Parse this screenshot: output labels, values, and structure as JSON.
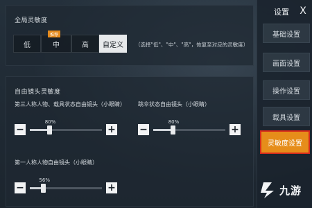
{
  "global_sensitivity": {
    "title": "全局灵敏度",
    "options": [
      {
        "label": "低",
        "selected": false
      },
      {
        "label": "中",
        "selected": false,
        "tag": "推荐"
      },
      {
        "label": "高",
        "selected": false
      },
      {
        "label": "自定义",
        "selected": true
      }
    ],
    "note": "（选择\"低\"、\"中\"、\"高\"，恢复至对应的灵敏度）"
  },
  "free_camera": {
    "title": "自由镜头灵敏度",
    "sliders": [
      {
        "label": "第三人称人物、载具状态自由镜头（小眼睛）",
        "value": 80,
        "value_text": "80%"
      },
      {
        "label": "跳伞状态自由镜头（小眼睛）",
        "value": 80,
        "value_text": "80%"
      },
      {
        "label": "第一人称人物自由镜头（小眼睛）",
        "value": 56,
        "value_text": "56%"
      }
    ],
    "slider_range": [
      0,
      300
    ],
    "minus_label": "−",
    "plus_label": "+"
  },
  "sidebar": {
    "title": "设置",
    "close_label": "X",
    "items": [
      {
        "label": "基础设置",
        "active": false
      },
      {
        "label": "画面设置",
        "active": false
      },
      {
        "label": "操作设置",
        "active": false
      },
      {
        "label": "载具设置",
        "active": false
      },
      {
        "label": "灵敏度设置",
        "active": true
      }
    ]
  },
  "watermark": {
    "text": "九游"
  },
  "colors": {
    "accent": "#e68d1a",
    "highlight_border": "#d62b1c",
    "tag": "#e58b1e"
  }
}
